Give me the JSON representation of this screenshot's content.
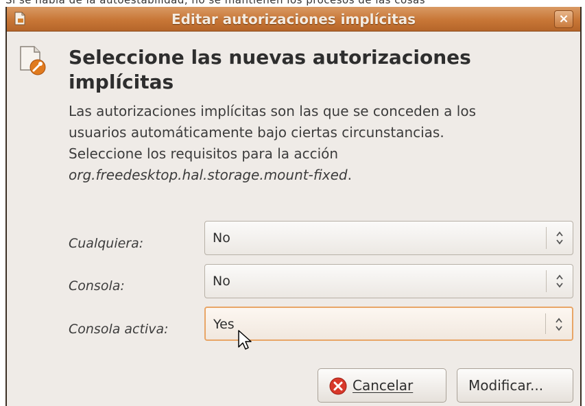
{
  "top_caption": "Si se habla de la autoestabilidad, no se mantienen los procesos de las cosas",
  "window": {
    "title": "Editar autorizaciones implícitas",
    "close_glyph": "×"
  },
  "header": {
    "heading": "Seleccione las nuevas autorizaciones implícitas",
    "description_prefix": "Las autorizaciones implícitas son las que se conceden a los usuarios automáticamente bajo ciertas circunstancias. Seleccione los requisitos para la acción ",
    "description_action": "org.freedesktop.hal.storage.mount-fixed",
    "description_suffix": "."
  },
  "fields": [
    {
      "label": "Cualquiera:",
      "value": "No"
    },
    {
      "label": "Consola:",
      "value": "No"
    },
    {
      "label": "Consola activa:",
      "value": "Yes"
    }
  ],
  "buttons": {
    "cancel": "Cancelar",
    "modify": "Modificar..."
  },
  "colors": {
    "titlebar": "#c87636",
    "focus_border": "#e8a566",
    "cancel_icon": "#d8382a"
  },
  "icons": {
    "app": "document-icon",
    "dialog": "authorization-icon",
    "close": "close-icon",
    "combo": "up-down-arrows-icon",
    "cancel": "cancel-icon",
    "cursor": "mouse-pointer"
  }
}
